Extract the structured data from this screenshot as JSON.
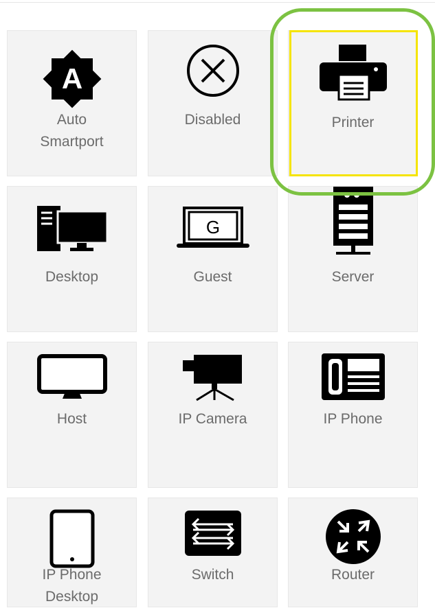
{
  "tiles": [
    {
      "label": "Auto\nSmartport",
      "icon": "auto-smartport-icon"
    },
    {
      "label": "Disabled",
      "icon": "disabled-icon"
    },
    {
      "label": "Printer",
      "icon": "printer-icon"
    },
    {
      "label": "Desktop",
      "icon": "desktop-icon"
    },
    {
      "label": "Guest",
      "icon": "guest-laptop-icon"
    },
    {
      "label": "Server",
      "icon": "server-icon"
    },
    {
      "label": "Host",
      "icon": "host-monitor-icon"
    },
    {
      "label": "IP Camera",
      "icon": "ip-camera-icon"
    },
    {
      "label": "IP Phone",
      "icon": "ip-phone-icon"
    },
    {
      "label": "IP Phone\nDesktop",
      "icon": "tablet-icon"
    },
    {
      "label": "Switch",
      "icon": "switch-icon"
    },
    {
      "label": "Router",
      "icon": "router-icon"
    }
  ],
  "guest_icon_letter": "G",
  "auto_icon_letter": "A",
  "highlight": {
    "selected_tile": "Printer",
    "outline_color": "#7cc242",
    "box_color": "#f5e400"
  }
}
